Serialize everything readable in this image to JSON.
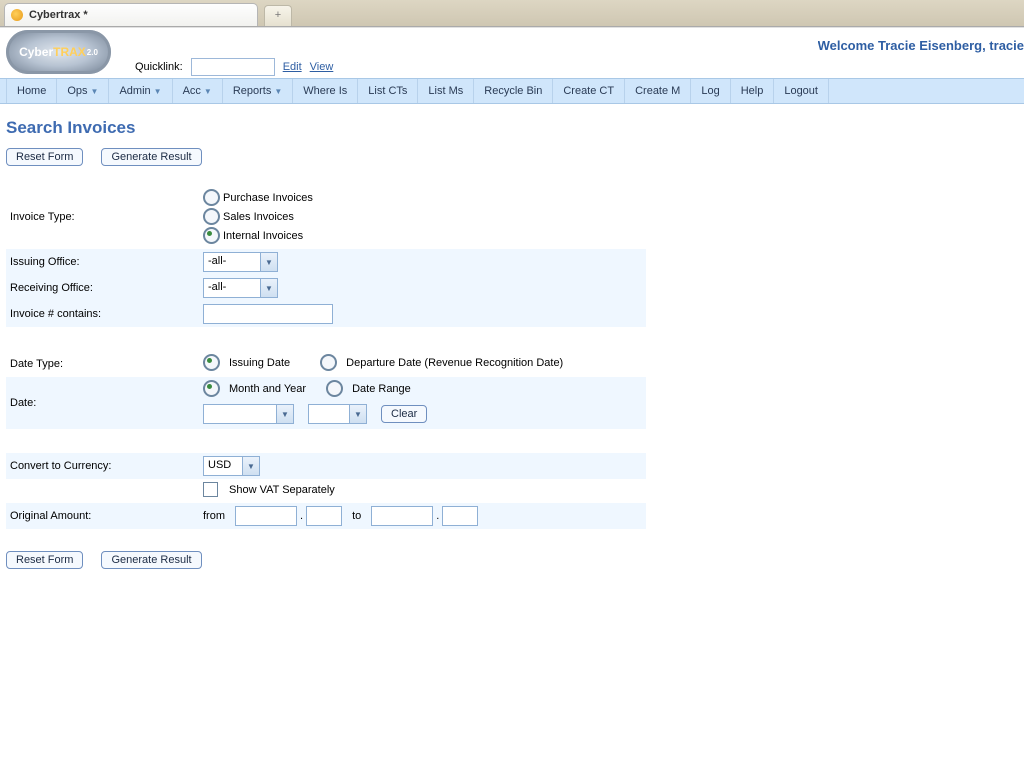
{
  "browser": {
    "tab_title": "Cybertrax *"
  },
  "header": {
    "welcome": "Welcome Tracie Eisenberg, tracie",
    "logo_a": "Cyber",
    "logo_b": "TRAX",
    "logo_c": "2.0",
    "quicklink_label": "Quicklink:",
    "quicklink_value": "",
    "edit": "Edit",
    "view": "View"
  },
  "menu": {
    "items": [
      {
        "label": "Home",
        "dd": false
      },
      {
        "label": "Ops",
        "dd": true
      },
      {
        "label": "Admin",
        "dd": true
      },
      {
        "label": "Acc",
        "dd": true
      },
      {
        "label": "Reports",
        "dd": true
      },
      {
        "label": "Where Is",
        "dd": false
      },
      {
        "label": "List CTs",
        "dd": false
      },
      {
        "label": "List Ms",
        "dd": false
      },
      {
        "label": "Recycle Bin",
        "dd": false
      },
      {
        "label": "Create CT",
        "dd": false
      },
      {
        "label": "Create M",
        "dd": false
      },
      {
        "label": "Log",
        "dd": false
      },
      {
        "label": "Help",
        "dd": false
      },
      {
        "label": "Logout",
        "dd": false
      }
    ]
  },
  "page": {
    "title": "Search Invoices",
    "reset_btn": "Reset Form",
    "generate_btn": "Generate Result"
  },
  "form": {
    "invoice_type_label": "Invoice Type:",
    "invoice_type": {
      "purchase": "Purchase Invoices",
      "sales": "Sales Invoices",
      "internal": "Internal Invoices"
    },
    "issuing_office_label": "Issuing Office:",
    "issuing_office_value": "-all-",
    "receiving_office_label": "Receiving Office:",
    "receiving_office_value": "-all-",
    "invoice_num_label": "Invoice # contains:",
    "invoice_num_value": "",
    "date_type_label": "Date Type:",
    "date_type": {
      "issuing": "Issuing Date",
      "departure": "Departure Date (Revenue Recognition Date)"
    },
    "date_label": "Date:",
    "date_mode": {
      "month_year": "Month and Year",
      "range": "Date Range"
    },
    "clear_btn": "Clear",
    "convert_currency_label": "Convert to Currency:",
    "convert_currency_value": "USD",
    "show_vat_label": "Show VAT Separately",
    "original_amount_label": "Original Amount:",
    "from_label": "from",
    "to_label": "to"
  }
}
